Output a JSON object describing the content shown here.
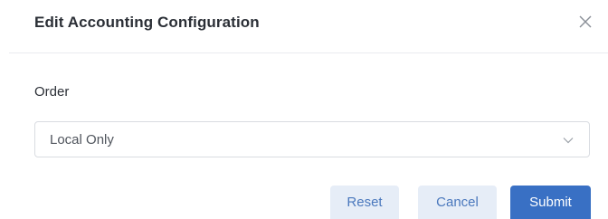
{
  "dialog": {
    "title": "Edit Accounting Configuration",
    "close_icon": "close-icon"
  },
  "form": {
    "order_label": "Order",
    "order_select": {
      "value": "Local Only",
      "icon": "chevron-down-icon"
    }
  },
  "footer": {
    "reset_label": "Reset",
    "cancel_label": "Cancel",
    "submit_label": "Submit"
  },
  "colors": {
    "primary": "#3970c4",
    "secondary_bg": "#e6edf7",
    "secondary_text": "#4a78bd"
  }
}
